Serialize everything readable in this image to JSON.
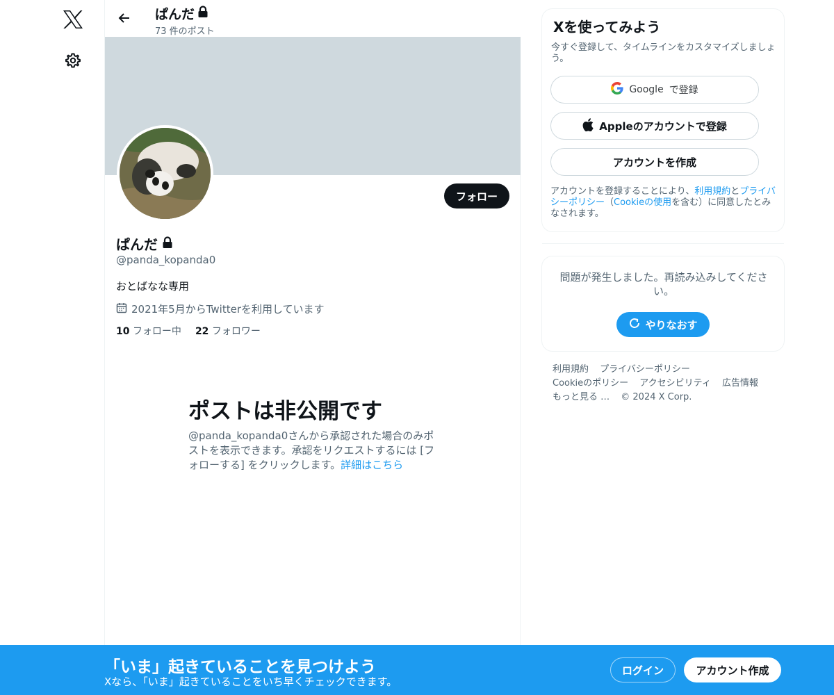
{
  "rail": {
    "logo_icon": "x-logo-icon",
    "settings_icon": "gear-icon"
  },
  "header": {
    "title": "ぱんだ",
    "post_count": "73 件のポスト"
  },
  "profile": {
    "name": "ぱんだ",
    "handle": "@panda_kopanda0",
    "bio": "おとばなな専用",
    "joined": "2021年5月からTwitterを利用しています",
    "following_count": "10",
    "following_label": "フォロー中",
    "followers_count": "22",
    "followers_label": "フォロワー",
    "follow_button": "フォロー"
  },
  "private": {
    "title": "ポストは非公開です",
    "description": "@panda_kopanda0さんから承認された場合のみポストを表示できます。承認をリクエストするには [フォローする] をクリックします。",
    "learn_more": "詳細はこちら"
  },
  "signup": {
    "title": "Xを使ってみよう",
    "subtitle": "今すぐ登録して、タイムラインをカスタマイズしましょう。",
    "google_brand": "Google",
    "google_suffix": "で登録",
    "apple_label": "Appleのアカウントで登録",
    "create_label": "アカウントを作成",
    "terms_prefix": "アカウントを登録することにより、",
    "terms_link": "利用規約",
    "terms_and": "と",
    "privacy_link": "プライバシーポリシー",
    "terms_mid": "（",
    "cookie_link": "Cookieの使用",
    "terms_suffix": "を含む）に同意したとみなされます。"
  },
  "error": {
    "message": "問題が発生しました。再読み込みしてください。",
    "retry_label": "やりなおす"
  },
  "footer": {
    "links": [
      "利用規約",
      "プライバシーポリシー",
      "Cookieのポリシー",
      "アクセシビリティ",
      "広告情報",
      "もっと見る …"
    ],
    "copyright": "© 2024 X Corp."
  },
  "bottom_bar": {
    "title": "「いま」起きていることを見つけよう",
    "subtitle": "Xなら、「いま」起きていることをいち早くチェックできます。",
    "login_label": "ログイン",
    "create_label": "アカウント作成"
  },
  "colors": {
    "accent": "#1d9bf0",
    "banner": "#cfd9de",
    "text": "#0f1419",
    "secondary": "#536471"
  }
}
